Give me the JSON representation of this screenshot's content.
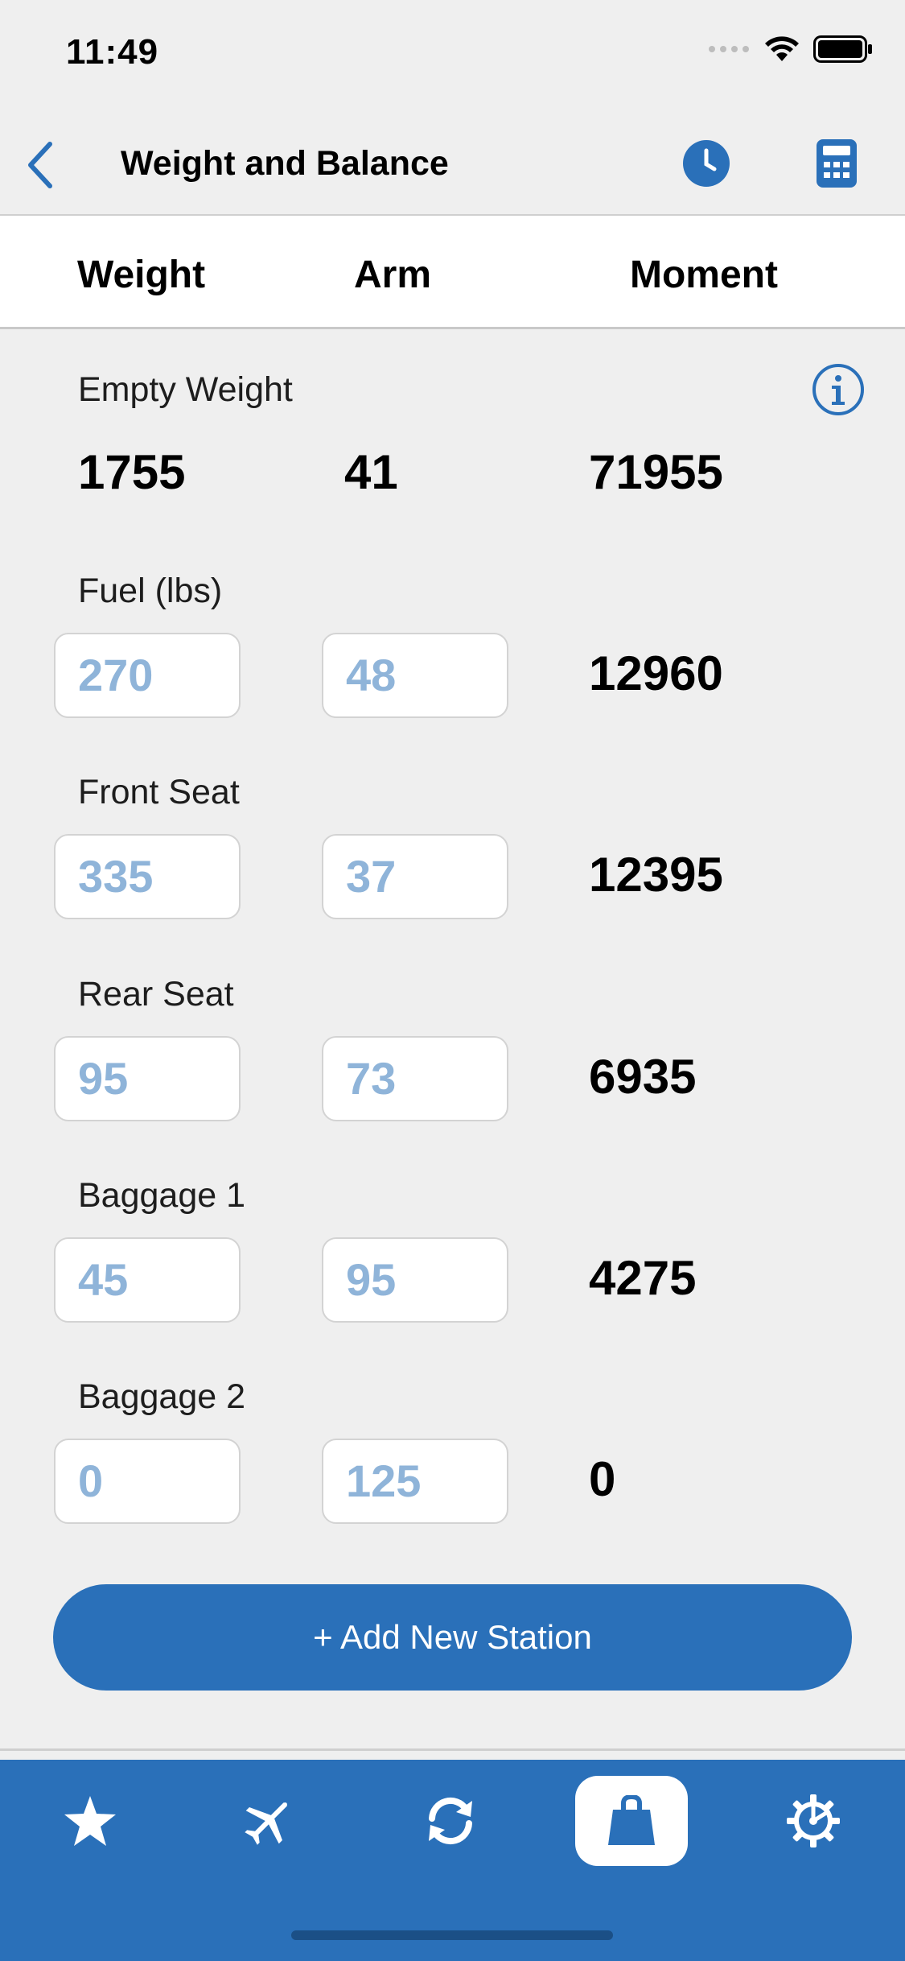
{
  "status": {
    "time": "11:49"
  },
  "header": {
    "title": "Weight and Balance"
  },
  "columns": {
    "weight": "Weight",
    "arm": "Arm",
    "moment": "Moment"
  },
  "empty_weight": {
    "label": "Empty Weight",
    "weight": "1755",
    "arm": "41",
    "moment": "71955"
  },
  "stations": [
    {
      "label": "Fuel (lbs)",
      "weight": "270",
      "arm": "48",
      "moment": "12960"
    },
    {
      "label": "Front Seat",
      "weight": "335",
      "arm": "37",
      "moment": "12395"
    },
    {
      "label": "Rear Seat",
      "weight": "95",
      "arm": "73",
      "moment": "6935"
    },
    {
      "label": "Baggage 1",
      "weight": "45",
      "arm": "95",
      "moment": "4275"
    },
    {
      "label": "Baggage 2",
      "weight": "0",
      "arm": "125",
      "moment": "0"
    }
  ],
  "actions": {
    "add_station": "+ Add New Station"
  },
  "tabs": [
    {
      "icon": "star-icon"
    },
    {
      "icon": "airplane-icon"
    },
    {
      "icon": "sync-icon"
    },
    {
      "icon": "weight-icon",
      "active": true
    },
    {
      "icon": "settings-icon"
    }
  ],
  "colors": {
    "accent": "#2a70b9",
    "field_text": "#8fb4d9",
    "background": "#efefef"
  }
}
